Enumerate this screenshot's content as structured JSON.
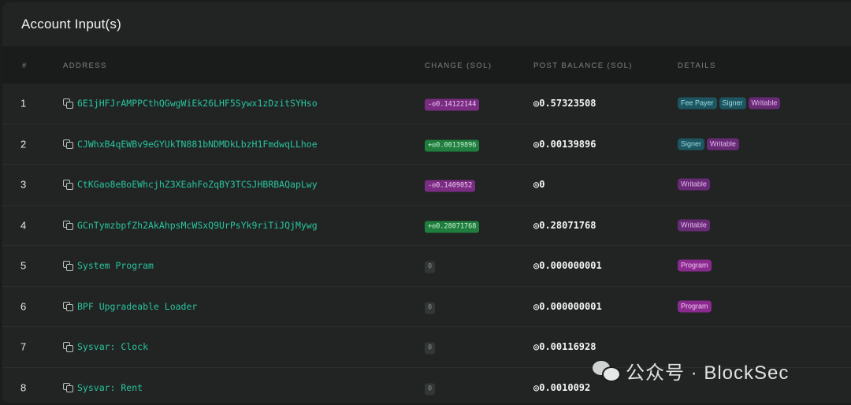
{
  "panel": {
    "title": "Account Input(s)"
  },
  "table": {
    "columns": [
      "#",
      "ADDRESS",
      "CHANGE (SOL)",
      "POST BALANCE (SOL)",
      "DETAILS"
    ],
    "rows": [
      {
        "index": "1",
        "address": "6E1jHFJrAMPPCthQGwgWiEk26LHF5Sywx1zDzitSYHso",
        "change": "-◎0.14122144",
        "change_kind": "neg",
        "balance": "◎0.57323508",
        "tags": [
          {
            "label": "Fee Payer",
            "kind": "teal"
          },
          {
            "label": "Signer",
            "kind": "teal"
          },
          {
            "label": "Writable",
            "kind": "purple"
          }
        ]
      },
      {
        "index": "2",
        "address": "CJWhxB4qEWBv9eGYUkTN881bNDMDkLbzH1FmdwqLLhoe",
        "change": "+◎0.00139896",
        "change_kind": "pos",
        "balance": "◎0.00139896",
        "tags": [
          {
            "label": "Signer",
            "kind": "teal"
          },
          {
            "label": "Writable",
            "kind": "purple"
          }
        ]
      },
      {
        "index": "3",
        "address": "CtKGao8eBoEWhcjhZ3XEahFoZqBY3TCSJHBRBAQapLwy",
        "change": "-◎0.1409052",
        "change_kind": "neg",
        "balance": "◎0",
        "tags": [
          {
            "label": "Writable",
            "kind": "purple"
          }
        ]
      },
      {
        "index": "4",
        "address": "GCnTymzbpfZh2AkAhpsMcWSxQ9UrPsYk9riTiJQjMywg",
        "change": "+◎0.28071768",
        "change_kind": "pos",
        "balance": "◎0.28071768",
        "tags": [
          {
            "label": "Writable",
            "kind": "purple"
          }
        ]
      },
      {
        "index": "5",
        "address": "System Program",
        "change": "0",
        "change_kind": "zero",
        "balance": "◎0.000000001",
        "tags": [
          {
            "label": "Program",
            "kind": "program"
          }
        ]
      },
      {
        "index": "6",
        "address": "BPF Upgradeable Loader",
        "change": "0",
        "change_kind": "zero",
        "balance": "◎0.000000001",
        "tags": [
          {
            "label": "Program",
            "kind": "program"
          }
        ]
      },
      {
        "index": "7",
        "address": "Sysvar: Clock",
        "change": "0",
        "change_kind": "zero",
        "balance": "◎0.00116928",
        "tags": []
      },
      {
        "index": "8",
        "address": "Sysvar: Rent",
        "change": "0",
        "change_kind": "zero",
        "balance": "◎0.0010092",
        "tags": []
      }
    ]
  },
  "watermark": {
    "text": "公众号 · BlockSec",
    "icon": "wechat-icon"
  }
}
